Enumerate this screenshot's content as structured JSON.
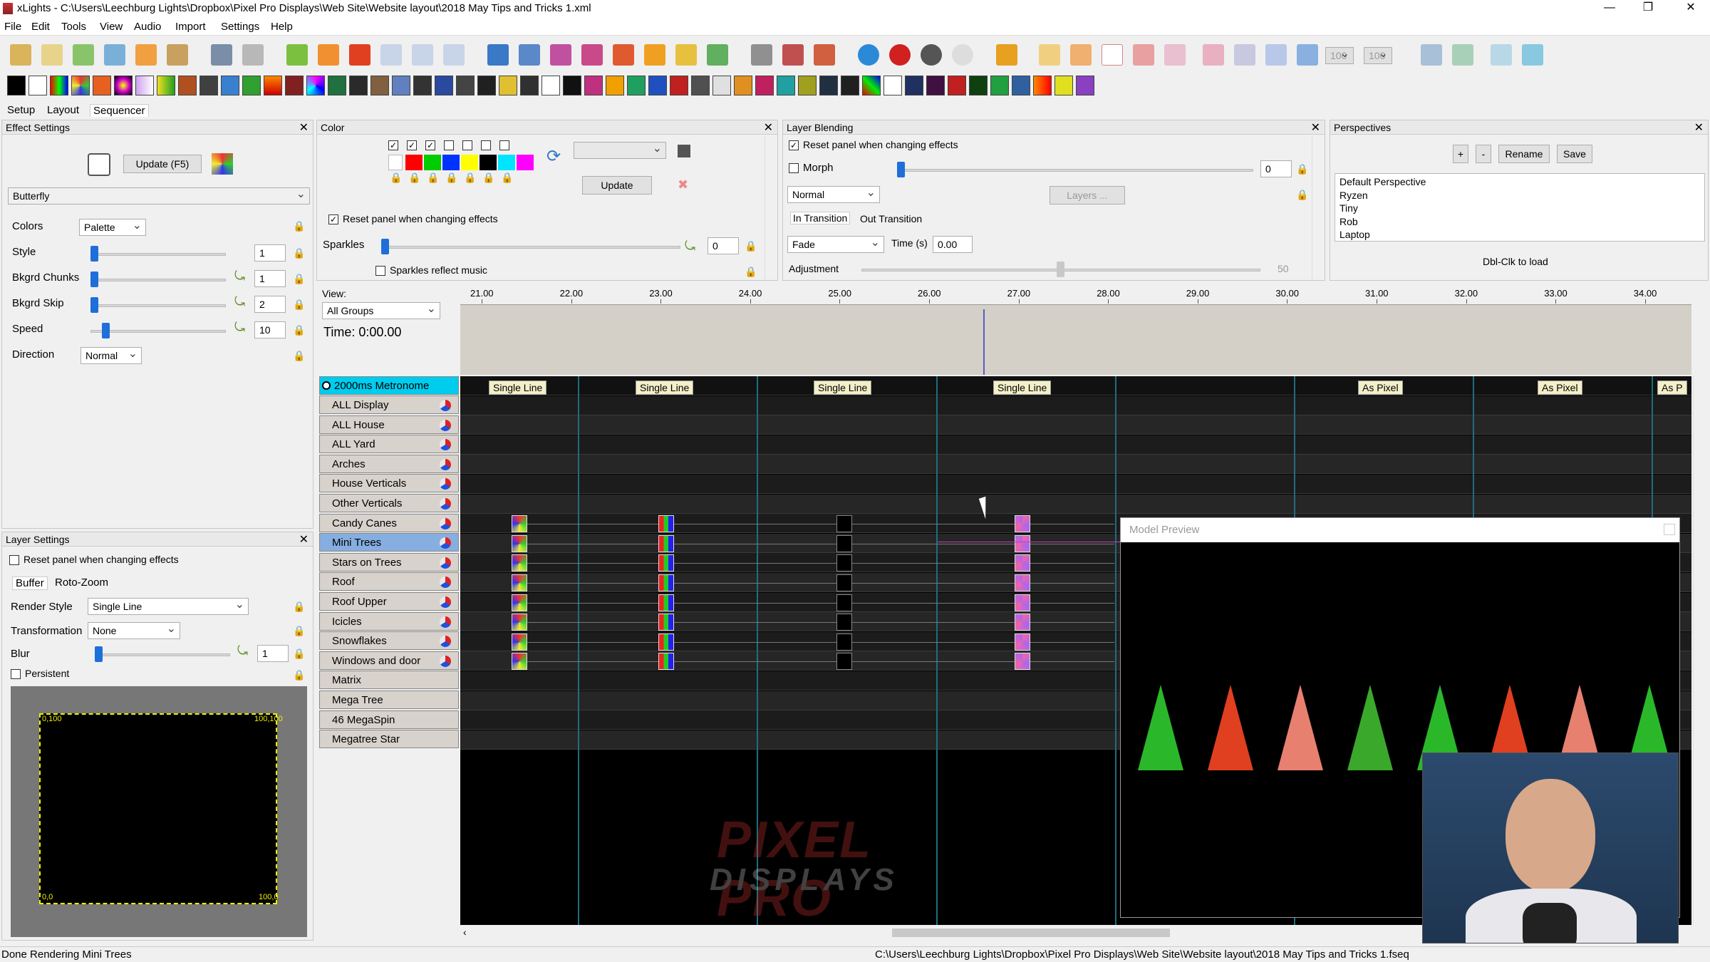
{
  "window": {
    "title": "xLights - C:\\Users\\Leechburg Lights\\Dropbox\\Pixel Pro Displays\\Web Site\\Website layout\\2018 May Tips and Tricks 1.xml"
  },
  "menu": [
    "File",
    "Edit",
    "Tools",
    "View",
    "Audio",
    "Import",
    "Settings",
    "Help"
  ],
  "toolbar": {
    "zoom_a": "100",
    "zoom_b": "100"
  },
  "tabs": [
    "Setup",
    "Layout",
    "Sequencer"
  ],
  "effect_settings": {
    "title": "Effect Settings",
    "update_button": "Update (F5)",
    "effect": "Butterfly",
    "colors_label": "Colors",
    "colors_value": "Palette",
    "style_label": "Style",
    "style_value": "1",
    "chunks_label": "Bkgrd Chunks",
    "chunks_value": "1",
    "skip_label": "Bkgrd Skip",
    "skip_value": "2",
    "speed_label": "Speed",
    "speed_value": "10",
    "direction_label": "Direction",
    "direction_value": "Normal"
  },
  "color_panel": {
    "title": "Color",
    "update_button": "Update",
    "reset_label": "Reset panel when changing effects",
    "sparkles_label": "Sparkles",
    "sparkles_value": "0",
    "sparkles_music_label": "Sparkles reflect music",
    "swatches": [
      "#ff0000",
      "#00cc00",
      "#0033ff",
      "#ffff00",
      "#000000",
      "#00e5ff",
      "#ff00ff"
    ]
  },
  "layer_blending": {
    "title": "Layer Blending",
    "reset_label": "Reset panel when changing effects",
    "morph_label": "Morph",
    "morph_value": "0",
    "blend_mode": "Normal",
    "layers_button": "Layers ...",
    "in_tab": "In Transition",
    "out_tab": "Out Transition",
    "transition": "Fade",
    "time_label": "Time (s)",
    "time_value": "0.00",
    "adjustment_label": "Adjustment",
    "adjustment_value": "50"
  },
  "perspectives": {
    "title": "Perspectives",
    "add": "+",
    "remove": "-",
    "rename": "Rename",
    "save": "Save",
    "items": [
      "Default Perspective",
      "Ryzen",
      "Tiny",
      "Rob",
      "Laptop"
    ],
    "hint": "Dbl-Clk to load"
  },
  "layer_settings": {
    "title": "Layer Settings",
    "reset_label": "Reset panel when changing effects",
    "tab_buffer": "Buffer",
    "tab_roto": "Roto-Zoom",
    "render_style_label": "Render Style",
    "render_style": "Single Line",
    "transformation_label": "Transformation",
    "transformation": "None",
    "blur_label": "Blur",
    "blur_value": "1",
    "persistent_label": "Persistent",
    "corner_tl": "0,100",
    "corner_tr": "100,100",
    "corner_bl": "0,0",
    "corner_br": "100,0"
  },
  "sequencer": {
    "view_label": "View:",
    "view_value": "All Groups",
    "time": "Time: 0:00.00",
    "ticks": [
      "21.00",
      "22.00",
      "23.00",
      "24.00",
      "25.00",
      "26.00",
      "27.00",
      "28.00",
      "29.00",
      "30.00",
      "31.00",
      "32.00",
      "33.00",
      "34.00"
    ],
    "timing_track": "2000ms Metronome",
    "timing_labels": [
      "Single Line",
      "Single Line",
      "Single Line",
      "Single Line",
      "As Pixel",
      "As Pixel",
      "As P"
    ],
    "rows": [
      "ALL Display",
      "ALL House",
      "ALL Yard",
      "Arches",
      "House Verticals",
      "Other Verticals",
      "Candy Canes",
      "Mini Trees",
      "Stars on Trees",
      "Roof",
      "Roof Upper",
      "Icicles",
      "Snowflakes",
      "Windows and door",
      "Matrix",
      "Mega Tree",
      "46 MegaSpin",
      "Megatree Star"
    ]
  },
  "preview": {
    "title": "Model Preview"
  },
  "watermark": {
    "line1": "PIXEL PRO",
    "line2": "DISPLAYS"
  },
  "status": {
    "left": "Done Rendering Mini Trees",
    "right": "C:\\Users\\Leechburg Lights\\Dropbox\\Pixel Pro Displays\\Web Site\\Website layout\\2018 May Tips and Tricks 1.fseq"
  }
}
